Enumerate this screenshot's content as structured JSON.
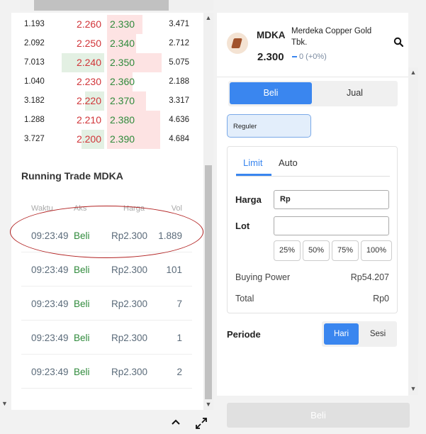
{
  "orderbook": {
    "rows": [
      {
        "bid_vol": "1.193",
        "bid_price": "2.260",
        "ask_price": "2.330",
        "ask_vol": "3.471",
        "bid_bar_pct": 0,
        "ask_bar_pct": 55
      },
      {
        "bid_vol": "2.092",
        "bid_price": "2.250",
        "ask_price": "2.340",
        "ask_vol": "2.712",
        "bid_bar_pct": 0,
        "ask_bar_pct": 45
      },
      {
        "bid_vol": "7.013",
        "bid_price": "2.240",
        "ask_price": "2.350",
        "ask_vol": "5.075",
        "bid_bar_pct": 100,
        "ask_bar_pct": 85
      },
      {
        "bid_vol": "1.040",
        "bid_price": "2.230",
        "ask_price": "2.360",
        "ask_vol": "2.188",
        "bid_bar_pct": 0,
        "ask_bar_pct": 40
      },
      {
        "bid_vol": "3.182",
        "bid_price": "2.220",
        "ask_price": "2.370",
        "ask_vol": "3.317",
        "bid_bar_pct": 45,
        "ask_bar_pct": 60
      },
      {
        "bid_vol": "1.288",
        "bid_price": "2.210",
        "ask_price": "2.380",
        "ask_vol": "4.636",
        "bid_bar_pct": 0,
        "ask_bar_pct": 82
      },
      {
        "bid_vol": "3.727",
        "bid_price": "2.200",
        "ask_price": "2.390",
        "ask_vol": "4.684",
        "bid_bar_pct": 53,
        "ask_bar_pct": 82
      }
    ]
  },
  "running_trade": {
    "title": "Running Trade MDKA",
    "headers": {
      "time": "Waktu",
      "action": "Aks",
      "price": "Harga",
      "vol": "Vol"
    },
    "rows": [
      {
        "time": "09:23:49",
        "action": "Beli",
        "price": "Rp2.300",
        "vol": "1.889"
      },
      {
        "time": "09:23:49",
        "action": "Beli",
        "price": "Rp2.300",
        "vol": "101"
      },
      {
        "time": "09:23:49",
        "action": "Beli",
        "price": "Rp2.300",
        "vol": "7"
      },
      {
        "time": "09:23:49",
        "action": "Beli",
        "price": "Rp2.300",
        "vol": "1"
      },
      {
        "time": "09:23:49",
        "action": "Beli",
        "price": "Rp2.300",
        "vol": "2"
      }
    ]
  },
  "stock": {
    "ticker": "MDKA",
    "company": "Merdeka Copper Gold Tbk.",
    "price": "2.300",
    "change": "0 (+0%)"
  },
  "trade_tabs": {
    "buy": "Beli",
    "sell": "Jual"
  },
  "board": {
    "selected": "Reguler"
  },
  "order": {
    "tabs": {
      "limit": "Limit",
      "auto": "Auto"
    },
    "price_label": "Harga",
    "price_value": "Rp",
    "lot_label": "Lot",
    "lot_value": "",
    "pct_buttons": [
      "25%",
      "50%",
      "75%",
      "100%"
    ],
    "buying_power_label": "Buying Power",
    "buying_power_value": "Rp54.207",
    "total_label": "Total",
    "total_value": "Rp0"
  },
  "period": {
    "label": "Periode",
    "options": [
      "Hari",
      "Sesi"
    ],
    "selected": "Hari"
  },
  "submit_label": "Beli",
  "colors": {
    "accent": "#3a86ef",
    "bid_red": "#d13438",
    "ask_green": "#2f8a3b",
    "annotation": "#b22222"
  }
}
